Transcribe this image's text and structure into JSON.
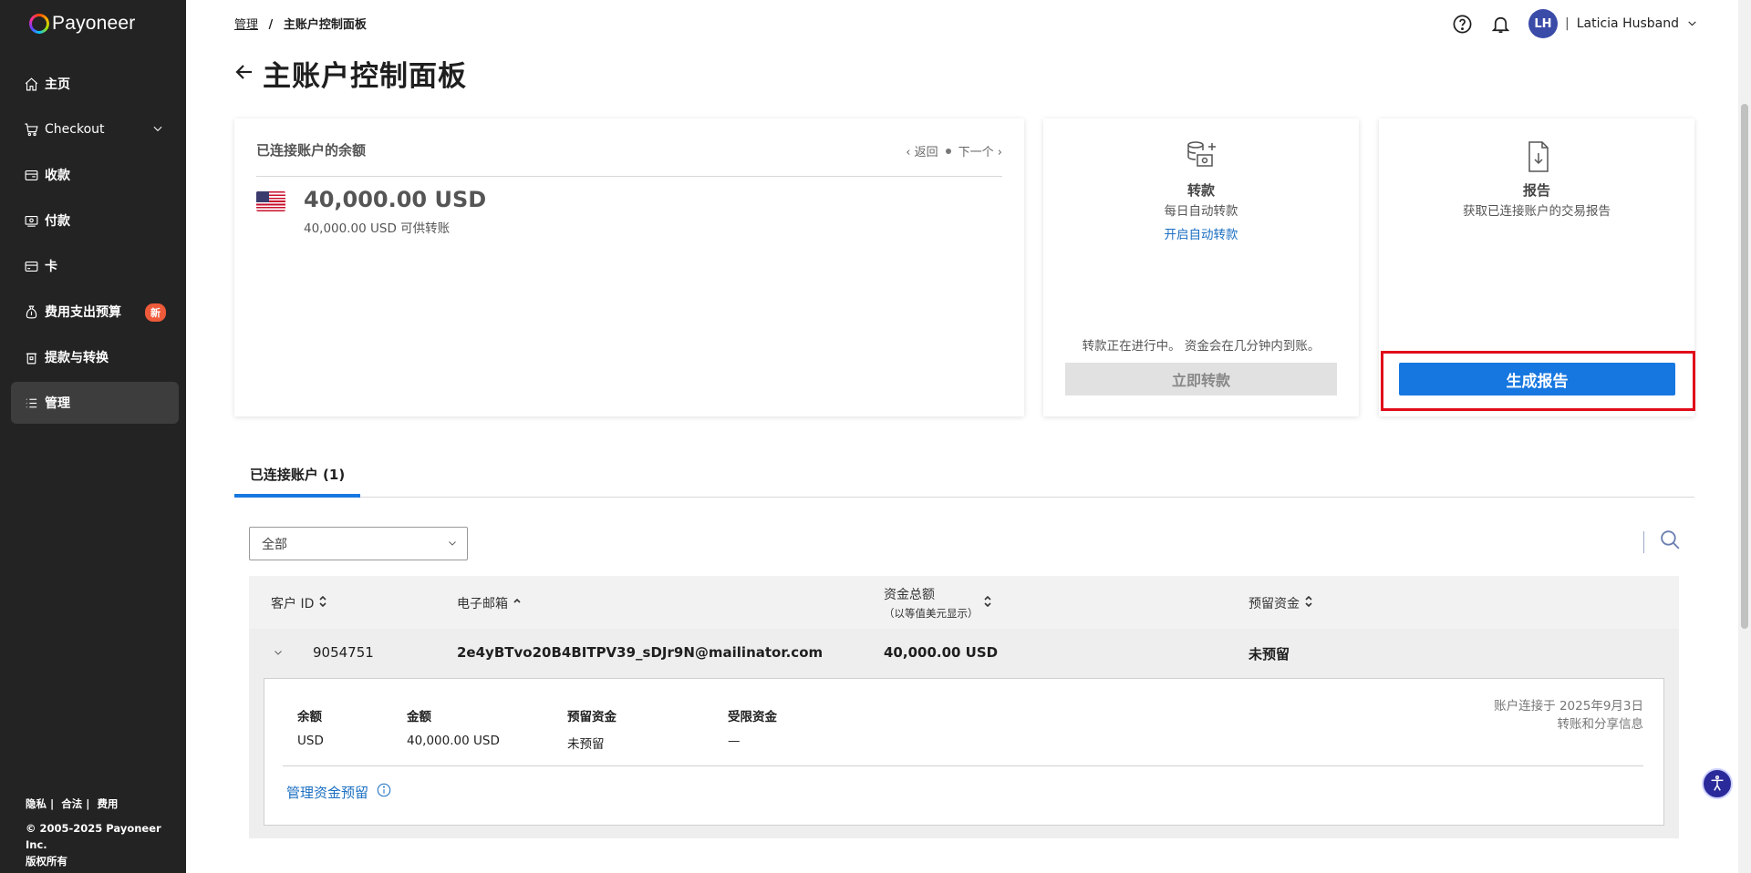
{
  "brand": {
    "name": "Payoneer"
  },
  "sidebar": {
    "items": [
      {
        "label": "主页",
        "icon": "home-icon"
      },
      {
        "label": "Checkout",
        "icon": "cart-icon"
      },
      {
        "label": "收款",
        "icon": "receive-icon"
      },
      {
        "label": "付款",
        "icon": "pay-icon"
      },
      {
        "label": "卡",
        "icon": "card-icon"
      },
      {
        "label": "费用支出预算",
        "icon": "budget-icon",
        "badge": "新"
      },
      {
        "label": "提款与转换",
        "icon": "withdraw-icon"
      },
      {
        "label": "管理",
        "icon": "list-icon",
        "active": true
      }
    ],
    "footer": {
      "links": [
        "隐私",
        "|",
        "合法",
        "|",
        "费用"
      ],
      "copyright": "© 2005-2025 Payoneer Inc.",
      "rights": "版权所有"
    }
  },
  "header": {
    "breadcrumb": {
      "parent": "管理",
      "separator": "/",
      "current": "主账户控制面板"
    },
    "title": "主账户控制面板",
    "user": {
      "initials": "LH",
      "separator": "|",
      "name": "Laticia Husband"
    }
  },
  "balance_card": {
    "title": "已连接账户的余额",
    "prev": "返回",
    "next": "下一个",
    "amount": "40,000.00 USD",
    "available": "40,000.00 USD 可供转账"
  },
  "transfer_card": {
    "title": "转款",
    "subtitle": "每日自动转款",
    "link": "开启自动转款",
    "note": "转款正在进行中。 资金会在几分钟内到账。",
    "button": "立即转款"
  },
  "report_card": {
    "title": "报告",
    "subtitle": "获取已连接账户的交易报告",
    "button": "生成报告"
  },
  "tabs": {
    "active": "已连接账户 (1)"
  },
  "filter": {
    "selected": "全部"
  },
  "table": {
    "headers": {
      "customer_id": "客户 ID",
      "email": "电子邮箱",
      "total": "资金总额",
      "total_note": "（以等值美元显示）",
      "reserved": "预留资金"
    },
    "rows": [
      {
        "customer_id": "9054751",
        "email": "2e4yBTvo20B4BITPV39_sDJr9N@mailinator.com",
        "total": "40,000.00 USD",
        "reserved": "未预留"
      }
    ],
    "detail": {
      "balance_label": "余额",
      "balance_value": "USD",
      "amount_label": "金额",
      "amount_value": "40,000.00 USD",
      "reserved_label": "预留资金",
      "reserved_value": "未预留",
      "restricted_label": "受限资金",
      "restricted_value": "—",
      "connected_on": "账户连接于 2025年9月3日",
      "transfer_info": "转账和分享信息",
      "manage_link": "管理资金预留"
    }
  },
  "colors": {
    "sidebar_bg": "#232323",
    "primary": "#1677e0",
    "link": "#1b6fc2",
    "highlight_outline": "#e00c1a",
    "new_badge": "#ee5a3a"
  }
}
